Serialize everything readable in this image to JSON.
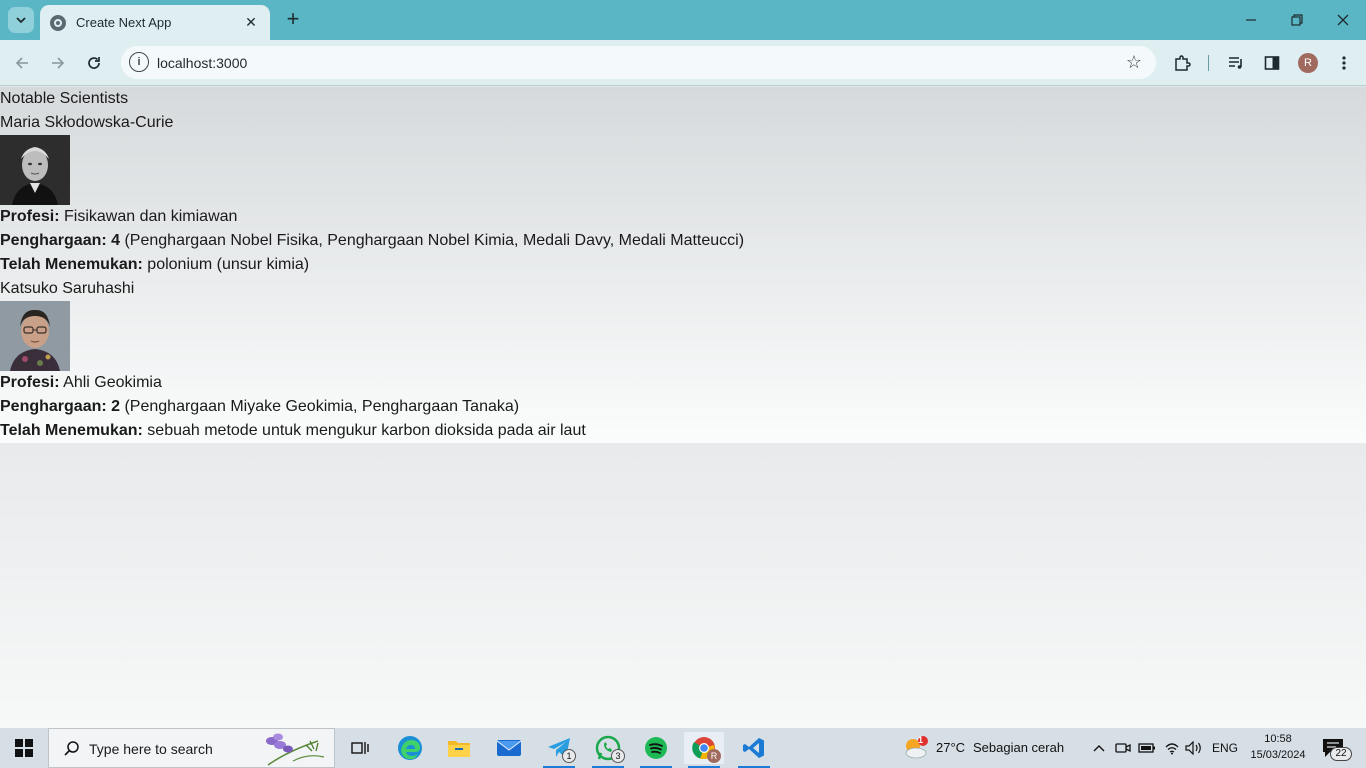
{
  "browser": {
    "tab_title": "Create Next App",
    "url": "localhost:3000",
    "profile_initial": "R"
  },
  "page": {
    "heading": "Notable Scientists",
    "scientists": [
      {
        "name": "Maria Skłodowska-Curie",
        "profession_label": "Profesi:",
        "profession": " Fisikawan dan kimiawan",
        "awards_label": "Penghargaan: 4",
        "awards": " (Penghargaan Nobel Fisika, Penghargaan Nobel Kimia, Medali Davy, Medali Matteucci)",
        "discovered_label": "Telah Menemukan:",
        "discovered": " polonium (unsur kimia)"
      },
      {
        "name": "Katsuko Saruhashi",
        "profession_label": "Profesi:",
        "profession": " Ahli Geokimia",
        "awards_label": "Penghargaan: 2",
        "awards": " (Penghargaan Miyake Geokimia, Penghargaan Tanaka)",
        "discovered_label": "Telah Menemukan:",
        "discovered": " sebuah metode untuk mengukur karbon dioksida pada air laut"
      }
    ]
  },
  "taskbar": {
    "search_placeholder": "Type here to search",
    "telegram_badge": "1",
    "whatsapp_badge": "3",
    "weather_alert": "1",
    "weather_temp": "27°C",
    "weather_desc": "Sebagian cerah",
    "language": "ENG",
    "time": "10:58",
    "date": "15/03/2024",
    "notification_count": "22"
  },
  "colors": {
    "titlebar": "#5ab6c4",
    "toolbar": "#dfeef1",
    "taskbar": "#d6dfe6"
  }
}
